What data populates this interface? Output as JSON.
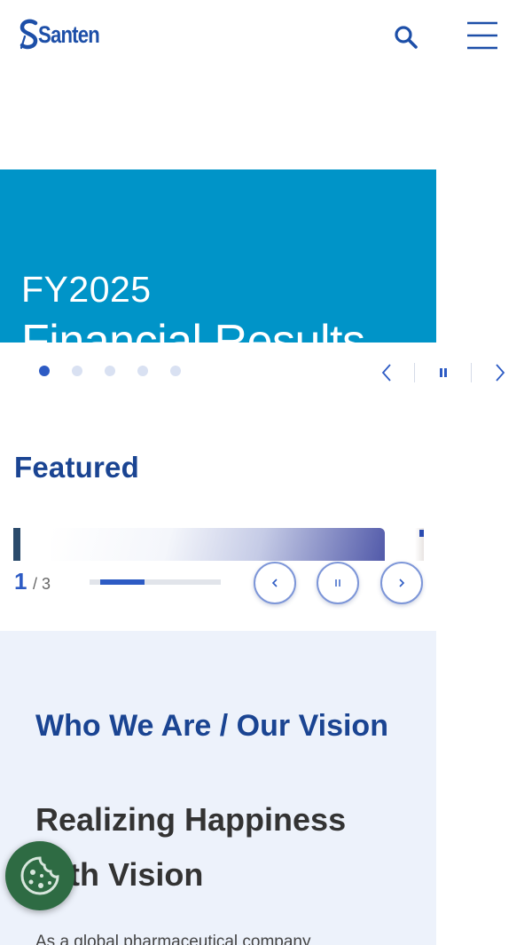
{
  "header": {
    "logo_text": "Santen",
    "icons": {
      "search": "search-icon",
      "menu": "hamburger-menu-icon"
    }
  },
  "hero": {
    "line1": "FY2025",
    "line2": "Financial Results",
    "background_color": "#0094c8",
    "slide_count": 5,
    "active_slide": 1,
    "controls": {
      "prev": "chevron-left-icon",
      "pause": "pause-icon",
      "next": "chevron-right-icon"
    }
  },
  "featured": {
    "title": "Featured",
    "current_page": "1",
    "page_separator": "/ 3",
    "total_pages": 3,
    "progress_fraction": 0.34,
    "controls": {
      "prev": "chevron-left-icon",
      "pause": "pause-icon",
      "next": "chevron-right-icon"
    }
  },
  "who": {
    "title": "Who We Are / Our Vision",
    "heading": "Realizing Happiness with Vision",
    "body": "As a global pharmaceutical company"
  },
  "cookie": {
    "icon": "cookie-icon",
    "color": "#2e6b43"
  },
  "colors": {
    "brand": "#1d4fa8",
    "accent": "#2d5bc4",
    "section_bg": "#edf2fb"
  }
}
